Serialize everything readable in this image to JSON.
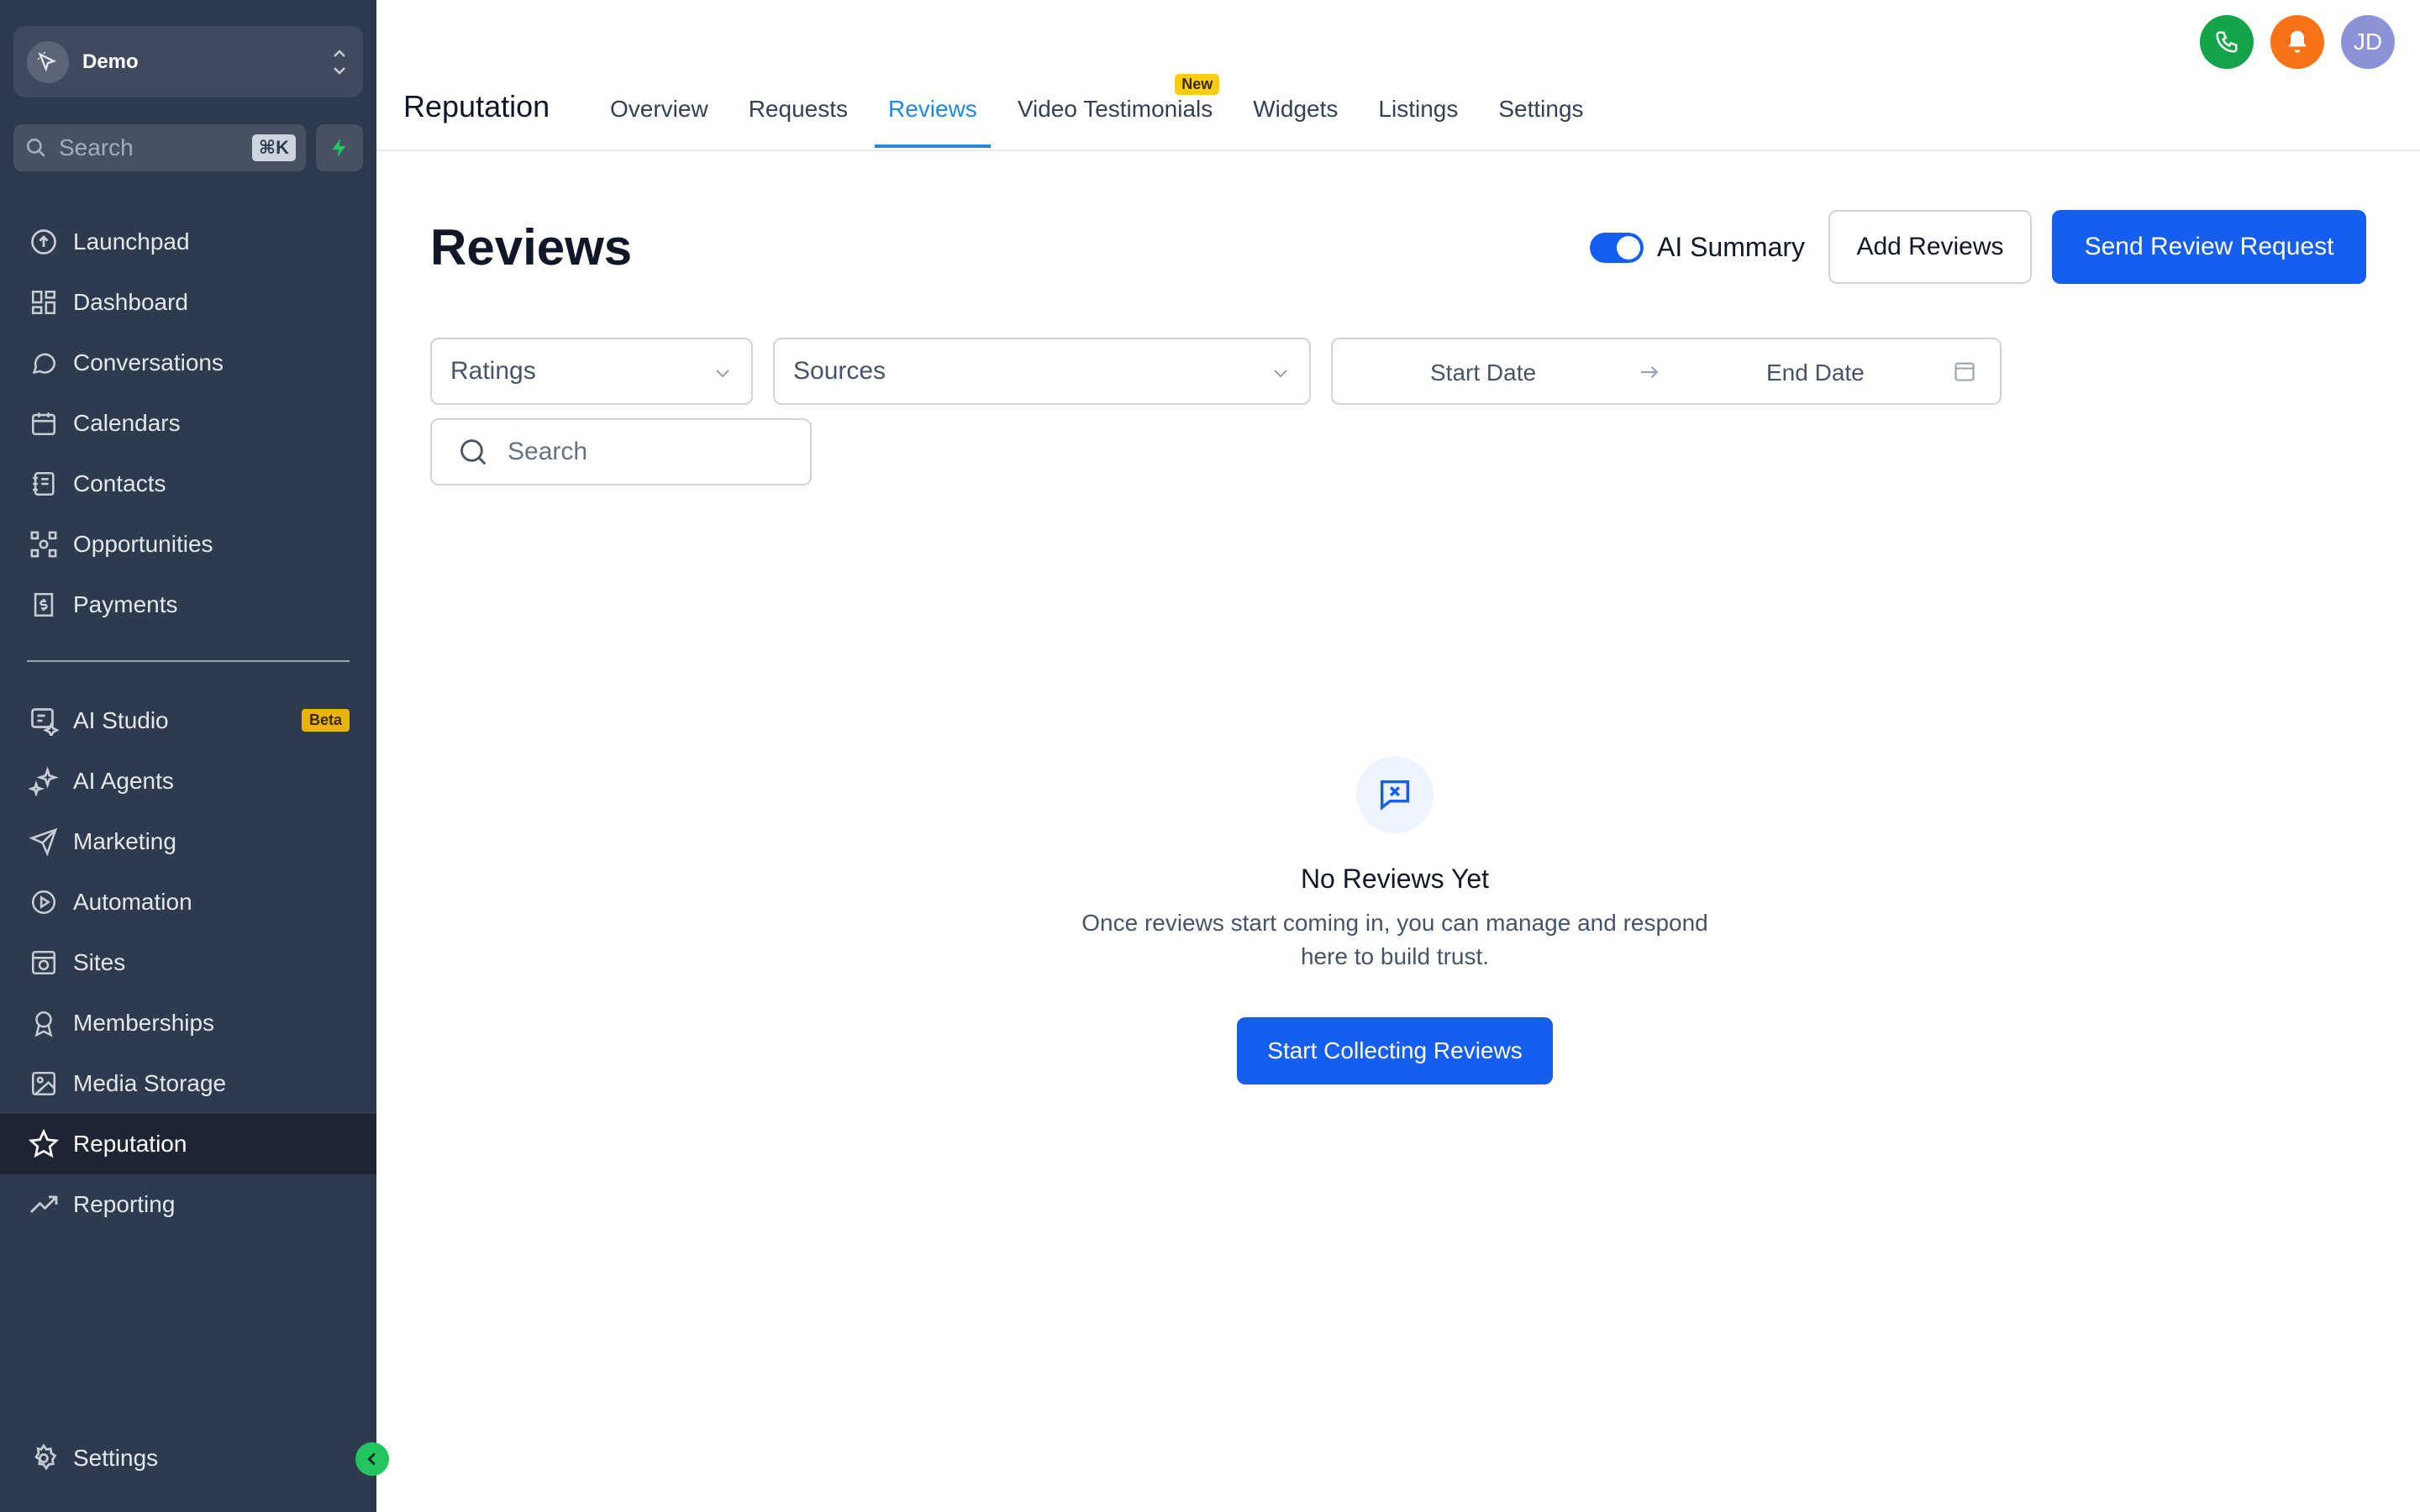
{
  "account": {
    "name": "Demo"
  },
  "sidebar_search": {
    "placeholder": "Search",
    "shortcut": "⌘K"
  },
  "nav_main": [
    {
      "label": "Launchpad",
      "icon": "launchpad-icon"
    },
    {
      "label": "Dashboard",
      "icon": "dashboard-icon"
    },
    {
      "label": "Conversations",
      "icon": "chat-icon"
    },
    {
      "label": "Calendars",
      "icon": "calendar-icon"
    },
    {
      "label": "Contacts",
      "icon": "contacts-icon"
    },
    {
      "label": "Opportunities",
      "icon": "opportunities-icon"
    },
    {
      "label": "Payments",
      "icon": "payments-icon"
    }
  ],
  "nav_secondary": [
    {
      "label": "AI Studio",
      "icon": "ai-studio-icon",
      "badge": "Beta"
    },
    {
      "label": "AI Agents",
      "icon": "sparkle-icon"
    },
    {
      "label": "Marketing",
      "icon": "send-icon"
    },
    {
      "label": "Automation",
      "icon": "play-circle-icon"
    },
    {
      "label": "Sites",
      "icon": "sites-icon"
    },
    {
      "label": "Memberships",
      "icon": "badge-icon"
    },
    {
      "label": "Media Storage",
      "icon": "image-icon"
    },
    {
      "label": "Reputation",
      "icon": "star-icon",
      "active": true
    },
    {
      "label": "Reporting",
      "icon": "trend-icon"
    }
  ],
  "nav_settings": {
    "label": "Settings",
    "icon": "gear-icon"
  },
  "header": {
    "app_title": "Reputation",
    "tabs": [
      {
        "label": "Overview"
      },
      {
        "label": "Requests"
      },
      {
        "label": "Reviews",
        "active": true
      },
      {
        "label": "Video Testimonials",
        "badge": "New"
      },
      {
        "label": "Widgets"
      },
      {
        "label": "Listings"
      },
      {
        "label": "Settings"
      }
    ],
    "avatar_initials": "JD",
    "colors": {
      "phone": "#16a34a",
      "bell": "#f97316",
      "avatar": "#8b93d6"
    }
  },
  "page": {
    "title": "Reviews",
    "ai_summary_label": "AI Summary",
    "ai_summary_enabled": true,
    "add_reviews_label": "Add Reviews",
    "send_request_label": "Send Review Request"
  },
  "filters": {
    "ratings_placeholder": "Ratings",
    "sources_placeholder": "Sources",
    "start_date_placeholder": "Start Date",
    "end_date_placeholder": "End Date",
    "search_placeholder": "Search"
  },
  "empty_state": {
    "title": "No Reviews Yet",
    "description": "Once reviews start coming in, you can manage and respond here to build trust.",
    "cta_label": "Start Collecting Reviews"
  },
  "colors": {
    "accent": "#155eef",
    "sidebar_bg": "#2e3a4e",
    "active_tab": "#1e88e5"
  }
}
